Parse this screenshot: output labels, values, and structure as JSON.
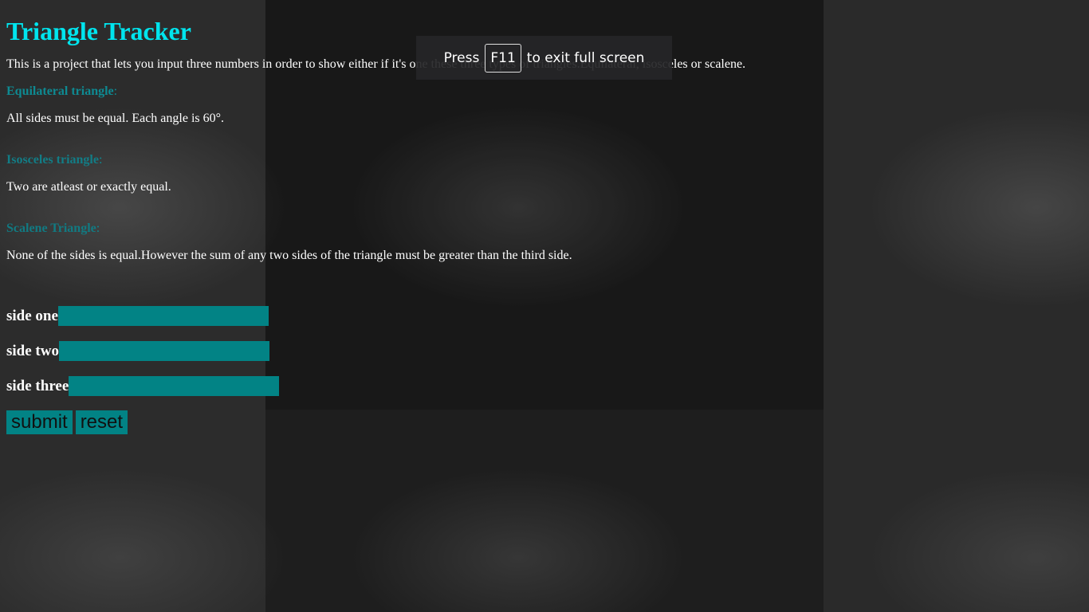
{
  "page": {
    "title": "Triangle Tracker",
    "intro": "This is a project that lets you input three numbers in order to show either if it's one these three types of triangles.Equilateral, isosceles or scalene."
  },
  "types": {
    "equilateral": {
      "heading": "Equilateral triangle",
      "colon": ":",
      "description": "All sides must be equal. Each angle is 60°."
    },
    "isosceles": {
      "heading": "Isosceles triangle",
      "colon": ":",
      "description": "Two are atleast or exactly equal."
    },
    "scalene": {
      "heading": "Scalene Triangle",
      "colon": ":",
      "description": "None of the sides is equal.However the sum of any two sides of the triangle must be greater than the third side."
    }
  },
  "form": {
    "side_one_label": "side one",
    "side_two_label": "side two",
    "side_three_label": "side three",
    "side_one_value": "",
    "side_two_value": "",
    "side_three_value": "",
    "submit_label": "submit",
    "reset_label": "reset"
  },
  "fullscreen_notice": {
    "prefix": "Press",
    "key": "F11",
    "suffix": "to exit full screen"
  },
  "colors": {
    "title": "#00e5ee",
    "heading": "#0e8a92",
    "input_bg": "#028385",
    "button_bg": "#028385"
  }
}
